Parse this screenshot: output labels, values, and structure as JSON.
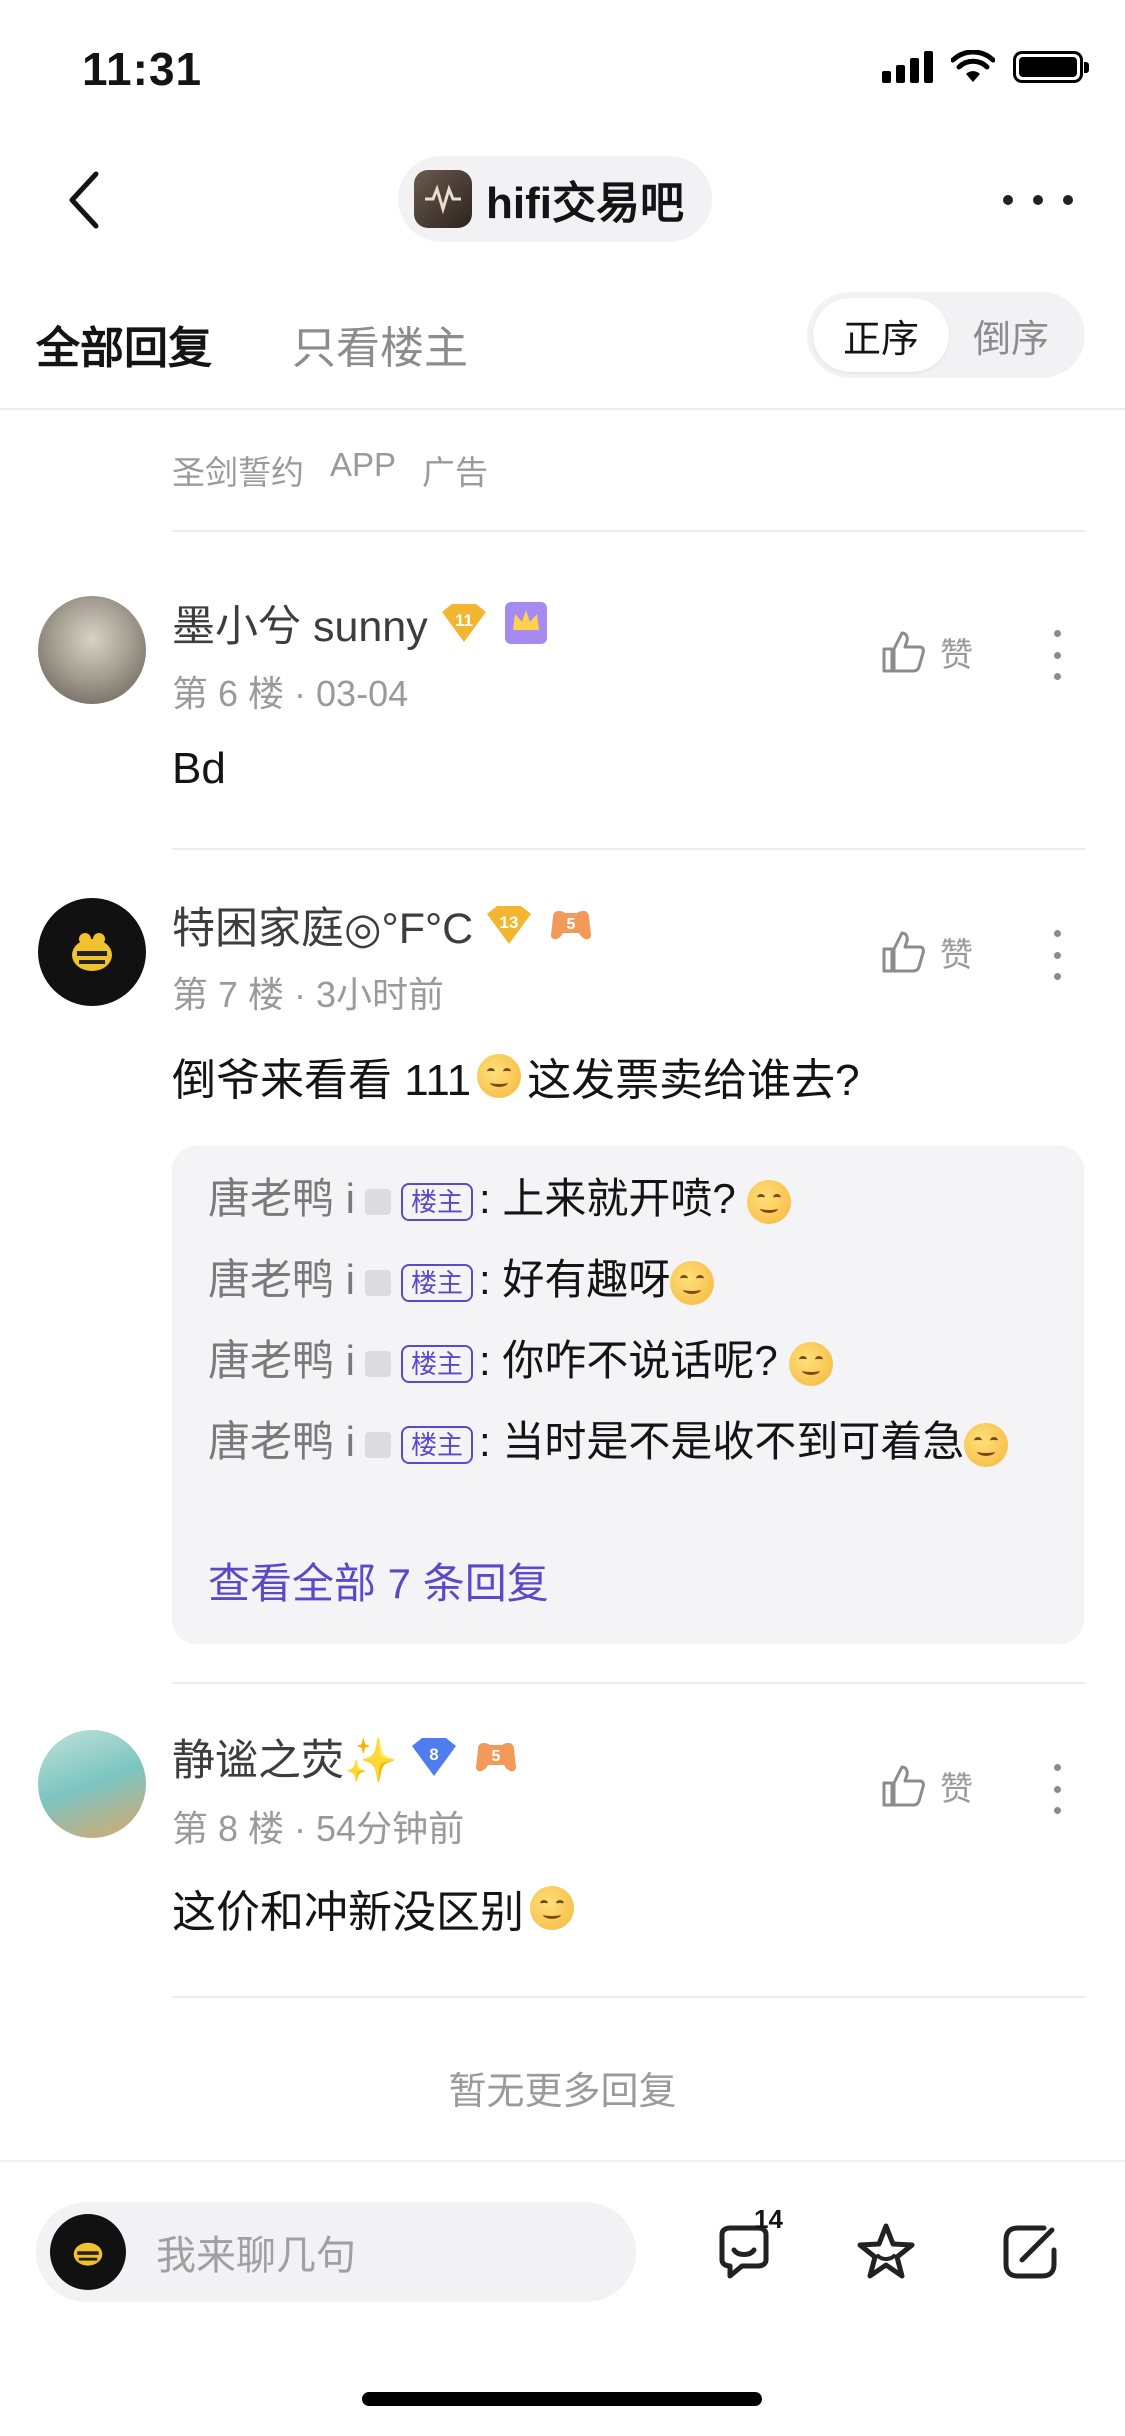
{
  "status_bar": {
    "time": "11:31"
  },
  "header": {
    "forum_name": "hifi交易吧"
  },
  "tabs": {
    "all": "全部回复",
    "op_only": "只看楼主"
  },
  "sort": {
    "ascending": "正序",
    "descending": "倒序"
  },
  "ad": {
    "items": [
      "圣剑誓约",
      "APP",
      "广告"
    ]
  },
  "like_label": "赞",
  "comments": [
    {
      "username": "墨小兮 sunny",
      "level": "11",
      "floor": "第 6 楼",
      "time": "03-04",
      "text": "Bd"
    },
    {
      "username": "特困家庭◎°F°C",
      "level": "13",
      "badge_num": "5",
      "floor": "第 7 楼",
      "time": "3小时前",
      "text_before": "倒爷来看看 111",
      "text_after": "这发票卖给谁去?",
      "replies": [
        {
          "user": "唐老鸭 i",
          "tag": "楼主",
          "text": "上来就开喷?"
        },
        {
          "user": "唐老鸭 i",
          "tag": "楼主",
          "text": "好有趣呀"
        },
        {
          "user": "唐老鸭 i",
          "tag": "楼主",
          "text": "你咋不说话呢?"
        },
        {
          "user": "唐老鸭 i",
          "tag": "楼主",
          "text": "当时是不是收不到可着急"
        }
      ],
      "view_all": "查看全部 7 条回复"
    },
    {
      "username": "静谧之荧✨",
      "level": "8",
      "badge_num": "5",
      "floor": "第 8 楼",
      "time": "54分钟前",
      "text": "这价和冲新没区别"
    }
  ],
  "no_more": "暂无更多回复",
  "bottom_bar": {
    "placeholder": "我来聊几句",
    "comment_count": "14"
  },
  "colors": {
    "accent": "#5b49c9",
    "gold": "#f2b630",
    "diamond": "#4f7df0"
  }
}
